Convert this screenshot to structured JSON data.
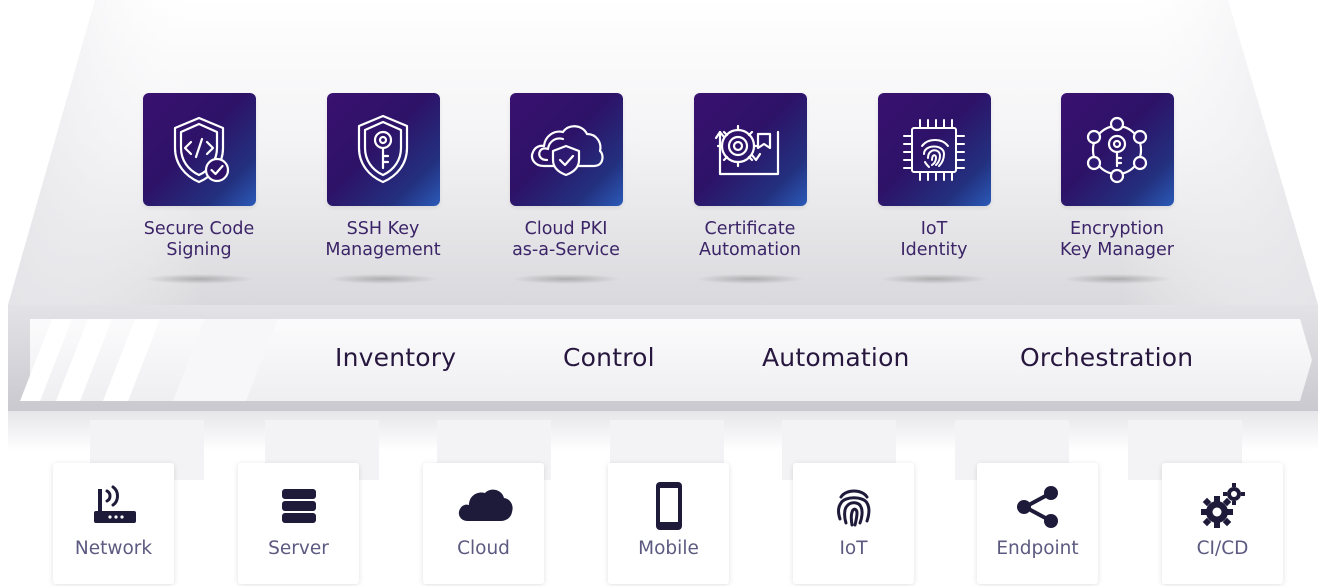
{
  "products": [
    {
      "id": "secure-code-signing",
      "label": "Secure Code\nSigning",
      "icon": "code-shield-check-icon"
    },
    {
      "id": "ssh-key-management",
      "label": "SSH Key\nManagement",
      "icon": "key-shield-icon"
    },
    {
      "id": "cloud-pki",
      "label": "Cloud PKI\nas-a-Service",
      "icon": "cloud-shield-icon"
    },
    {
      "id": "certificate-automation",
      "label": "Certificate\nAutomation",
      "icon": "gear-certificate-icon"
    },
    {
      "id": "iot-identity",
      "label": "IoT\nIdentity",
      "icon": "chip-fingerprint-icon"
    },
    {
      "id": "encryption-key-manager",
      "label": "Encryption\nKey Manager",
      "icon": "key-network-icon"
    }
  ],
  "band": {
    "labels": [
      "Inventory",
      "Control",
      "Automation",
      "Orchestration"
    ]
  },
  "endpoints": [
    {
      "id": "network",
      "label": "Network",
      "icon": "router-icon"
    },
    {
      "id": "server",
      "label": "Server",
      "icon": "server-icon"
    },
    {
      "id": "cloud",
      "label": "Cloud",
      "icon": "cloud-icon"
    },
    {
      "id": "mobile",
      "label": "Mobile",
      "icon": "mobile-icon"
    },
    {
      "id": "iot",
      "label": "IoT",
      "icon": "fingerprint-icon"
    },
    {
      "id": "endpoint",
      "label": "Endpoint",
      "icon": "share-nodes-icon"
    },
    {
      "id": "cicd",
      "label": "CI/CD",
      "icon": "gears-icon"
    }
  ],
  "colors": {
    "tile_gradient_start": "#3a1170",
    "tile_gradient_end": "#2a5ab8",
    "product_label": "#3b2467",
    "band_label": "#27173f",
    "endpoint_icon": "#1e1a3a",
    "endpoint_label": "#5c5a80"
  }
}
